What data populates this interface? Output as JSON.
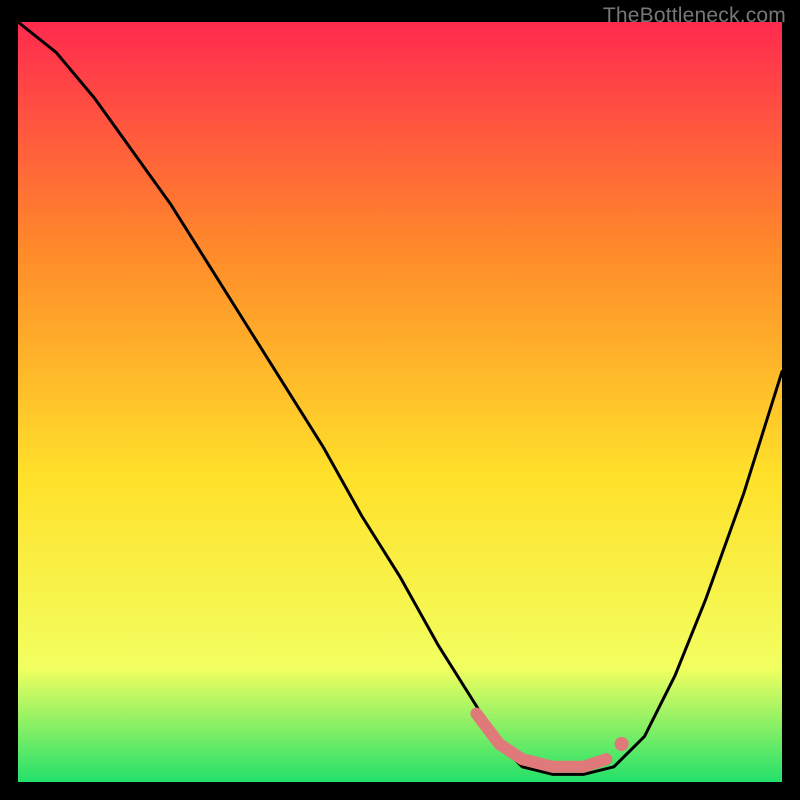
{
  "watermark": "TheBottleneck.com",
  "chart_data": {
    "type": "line",
    "title": "",
    "xlabel": "",
    "ylabel": "",
    "xlim": [
      0,
      100
    ],
    "ylim": [
      0,
      100
    ],
    "background_gradient": {
      "top": "#ff2a4f",
      "mid_upper": "#ff8a2a",
      "mid": "#ffe12a",
      "mid_lower": "#f2ff60",
      "bottom": "#22e06a"
    },
    "series": [
      {
        "name": "bottleneck-curve",
        "color": "#000000",
        "x": [
          0,
          5,
          10,
          15,
          20,
          25,
          30,
          35,
          40,
          45,
          50,
          55,
          60,
          63,
          66,
          70,
          74,
          78,
          82,
          86,
          90,
          95,
          100
        ],
        "y": [
          100,
          96,
          90,
          83,
          76,
          68,
          60,
          52,
          44,
          35,
          27,
          18,
          10,
          5,
          2,
          1,
          1,
          2,
          6,
          14,
          24,
          38,
          54
        ]
      }
    ],
    "highlight_segment": {
      "name": "optimal-range",
      "color": "#e07a7a",
      "x": [
        60,
        63,
        66,
        70,
        74,
        77
      ],
      "y": [
        9,
        5,
        3,
        2,
        2,
        3
      ]
    },
    "highlight_dot": {
      "name": "marker",
      "color": "#e07a7a",
      "x": 79,
      "y": 5
    }
  }
}
